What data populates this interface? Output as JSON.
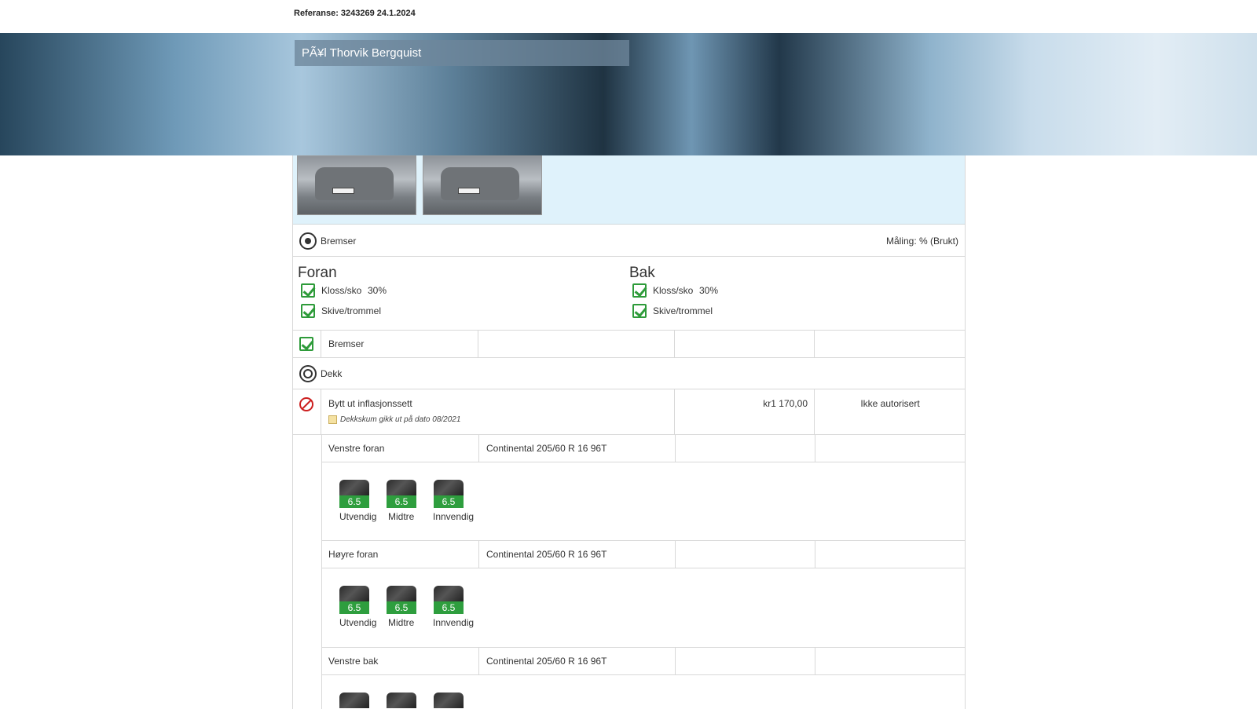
{
  "header": {
    "reference": "Referanse: 3243269 24.1.2024"
  },
  "banner": {
    "customer_name": "PÃ¥l Thorvik Bergquist"
  },
  "brakes_section": {
    "title": "Bremser",
    "measure_label": "Måling: % (Brukt)",
    "front": {
      "heading": "Foran",
      "items": [
        {
          "label": "Kloss/sko",
          "value": "30%"
        },
        {
          "label": "Skive/trommel",
          "value": ""
        }
      ]
    },
    "rear": {
      "heading": "Bak",
      "items": [
        {
          "label": "Kloss/sko",
          "value": "30%"
        },
        {
          "label": "Skive/trommel",
          "value": ""
        }
      ]
    },
    "row_label": "Bremser"
  },
  "tires_section": {
    "title": "Dekk",
    "action": {
      "label": "Bytt ut inflasjonssett",
      "note": "Dekkskum gikk ut på dato 08/2021",
      "price": "kr1 170,00",
      "status": "Ikke autorisert"
    },
    "tires": [
      {
        "position": "Venstre foran",
        "spec": "Continental 205/60 R 16 96T",
        "tread": [
          {
            "label": "Utvendig",
            "depth": "6.5"
          },
          {
            "label": "Midtre",
            "depth": "6.5"
          },
          {
            "label": "Innvendig",
            "depth": "6.5"
          }
        ]
      },
      {
        "position": "Høyre foran",
        "spec": "Continental 205/60 R 16 96T",
        "tread": [
          {
            "label": "Utvendig",
            "depth": "6.5"
          },
          {
            "label": "Midtre",
            "depth": "6.5"
          },
          {
            "label": "Innvendig",
            "depth": "6.5"
          }
        ]
      },
      {
        "position": "Venstre bak",
        "spec": "Continental 205/60 R 16 96T",
        "tread": []
      }
    ]
  }
}
